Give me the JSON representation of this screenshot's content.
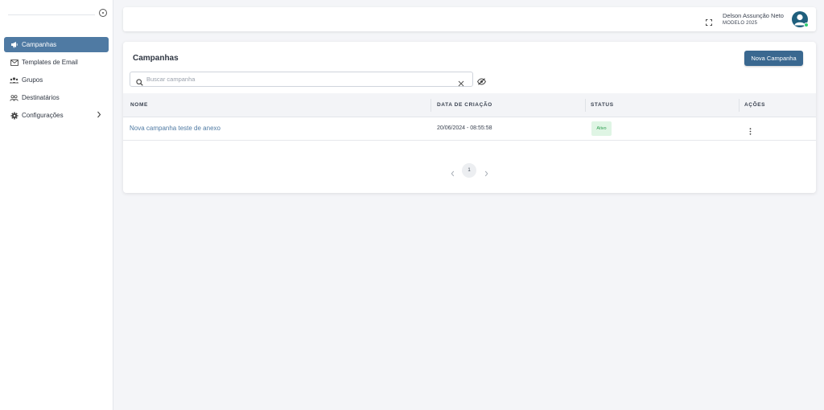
{
  "sidebar": {
    "items": [
      {
        "label": "Campanhas",
        "icon": "megaphone-icon",
        "active": true
      },
      {
        "label": "Templates de Email",
        "icon": "envelope-icon",
        "active": false
      },
      {
        "label": "Grupos",
        "icon": "users-group-icon",
        "active": false
      },
      {
        "label": "Destinatários",
        "icon": "people-icon",
        "active": false
      },
      {
        "label": "Configurações",
        "icon": "gear-icon",
        "active": false,
        "has_submenu": true
      }
    ]
  },
  "header": {
    "user_name": "Delson Assunção Neto",
    "user_subtitle": "MODELO 2025",
    "status_color": "#2ecc71"
  },
  "main": {
    "title": "Campanhas",
    "new_button_label": "Nova Campanha",
    "search": {
      "placeholder": "Buscar campanha",
      "value": ""
    },
    "table": {
      "columns": [
        "NOME",
        "DATA DE CRIAÇÃO",
        "STATUS",
        "AÇÕES"
      ],
      "rows": [
        {
          "name": "Nova campanha teste de anexo",
          "created": "20/06/2024 - 08:55:58",
          "status": "Ativo"
        }
      ]
    },
    "pagination": {
      "current_page": "1"
    }
  },
  "colors": {
    "accent": "#3a6890",
    "active_nav": "#4f7aa3",
    "badge_bg": "#dff5e4",
    "badge_text": "#2e9e4f"
  }
}
